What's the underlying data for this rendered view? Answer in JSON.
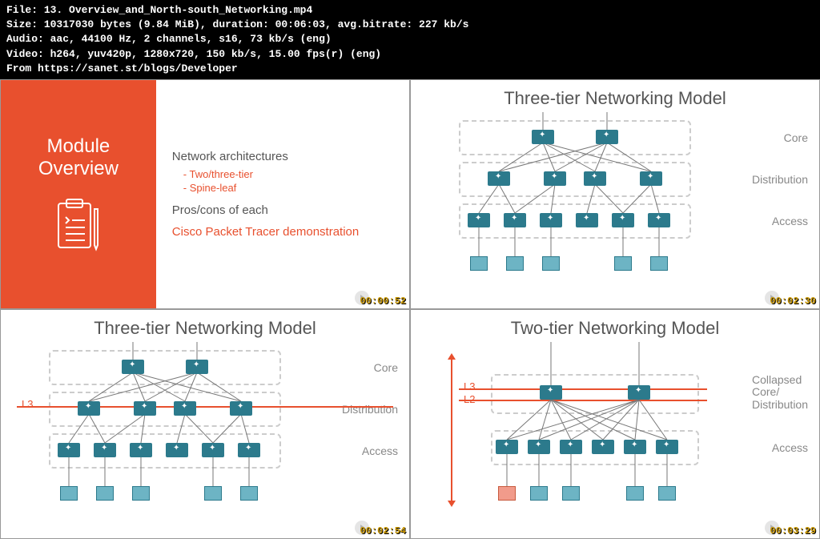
{
  "header": {
    "file_label": "File:",
    "file_value": "13. Overview_and_North-south_Networking.mp4",
    "size_label": "Size:",
    "size_bytes": "10317030",
    "size_unit": "bytes",
    "size_mib": "(9.84 MiB),",
    "duration_label": "duration:",
    "duration_value": "00:06:03,",
    "bitrate_label": "avg.bitrate:",
    "bitrate_value": "227 kb/s",
    "audio_label": "Audio:",
    "audio_value": "aac, 44100 Hz, 2 channels, s16, 73 kb/s (eng)",
    "video_label": "Video:",
    "video_value": "h264, yuv420p, 1280x720, 150 kb/s, 15.00 fps(r) (eng)",
    "from_label": "From",
    "from_value": "https://sanet.st/blogs/Developer"
  },
  "panel1": {
    "title": "Module\nOverview",
    "arch": "Network architectures",
    "sub1": "Two/three-tier",
    "sub2": "Spine-leaf",
    "pros": "Pros/cons of each",
    "demo": "Cisco Packet Tracer demonstration",
    "timestamp": "00:00:52"
  },
  "panel2": {
    "title": "Three-tier Networking Model",
    "tiers": [
      "Core",
      "Distribution",
      "Access"
    ],
    "timestamp": "00:02:30"
  },
  "panel3": {
    "title": "Three-tier Networking Model",
    "tiers": [
      "Core",
      "Distribution",
      "Access"
    ],
    "l3": "L3",
    "timestamp": "00:02:54"
  },
  "panel4": {
    "title": "Two-tier Networking Model",
    "l3": "L3",
    "l2": "L2",
    "tier_collapsed": "Collapsed\nCore/\nDistribution",
    "tier_access": "Access",
    "timestamp": "00:03:29"
  },
  "chart_data": {
    "type": "diagram",
    "description": "Cisco network architecture tier models",
    "three_tier": {
      "tiers": [
        "Core",
        "Distribution",
        "Access"
      ],
      "core_switches": 2,
      "distribution_switches": 4,
      "access_switches": 6,
      "hosts": 5,
      "l3_boundary": "between Core and Distribution"
    },
    "two_tier": {
      "tiers": [
        "Collapsed Core/Distribution",
        "Access"
      ],
      "collapsed_switches": 2,
      "access_switches": 6,
      "hosts": 5,
      "l3_l2_boundary": "at Collapsed layer"
    }
  }
}
